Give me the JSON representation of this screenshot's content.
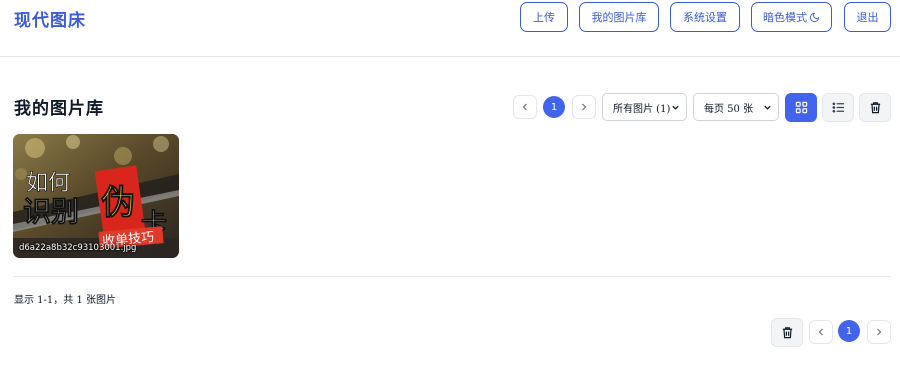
{
  "header": {
    "brand": "现代图床",
    "nav": {
      "upload": "上传",
      "library": "我的图片库",
      "settings": "系统设置",
      "dark_mode": "暗色模式",
      "logout": "退出"
    }
  },
  "main": {
    "title": "我的图片库",
    "pagination": {
      "current_page": "1"
    },
    "filter_select": {
      "value": "所有图片 (1)"
    },
    "per_page_select": {
      "value": "每页 50 张"
    },
    "view_mode": "grid",
    "images": [
      {
        "filename": "d6a22a8b32c93103001.jpg",
        "overlay_text": {
          "line1": "如何",
          "line2a": "识别",
          "line2b": "伪",
          "line2c": "卡",
          "line3": "收单技巧"
        }
      }
    ],
    "summary": "显示 1-1，共 1 张图片",
    "bottom_pagination": {
      "current_page": "1"
    }
  },
  "colors": {
    "accent": "#4263eb",
    "brand": "#3b5bdb",
    "border": "#e5e7eb"
  },
  "icons": [
    "moon-icon",
    "chevron-left-icon",
    "chevron-right-icon",
    "chevron-down-icon",
    "grid-icon",
    "list-icon",
    "trash-icon"
  ]
}
